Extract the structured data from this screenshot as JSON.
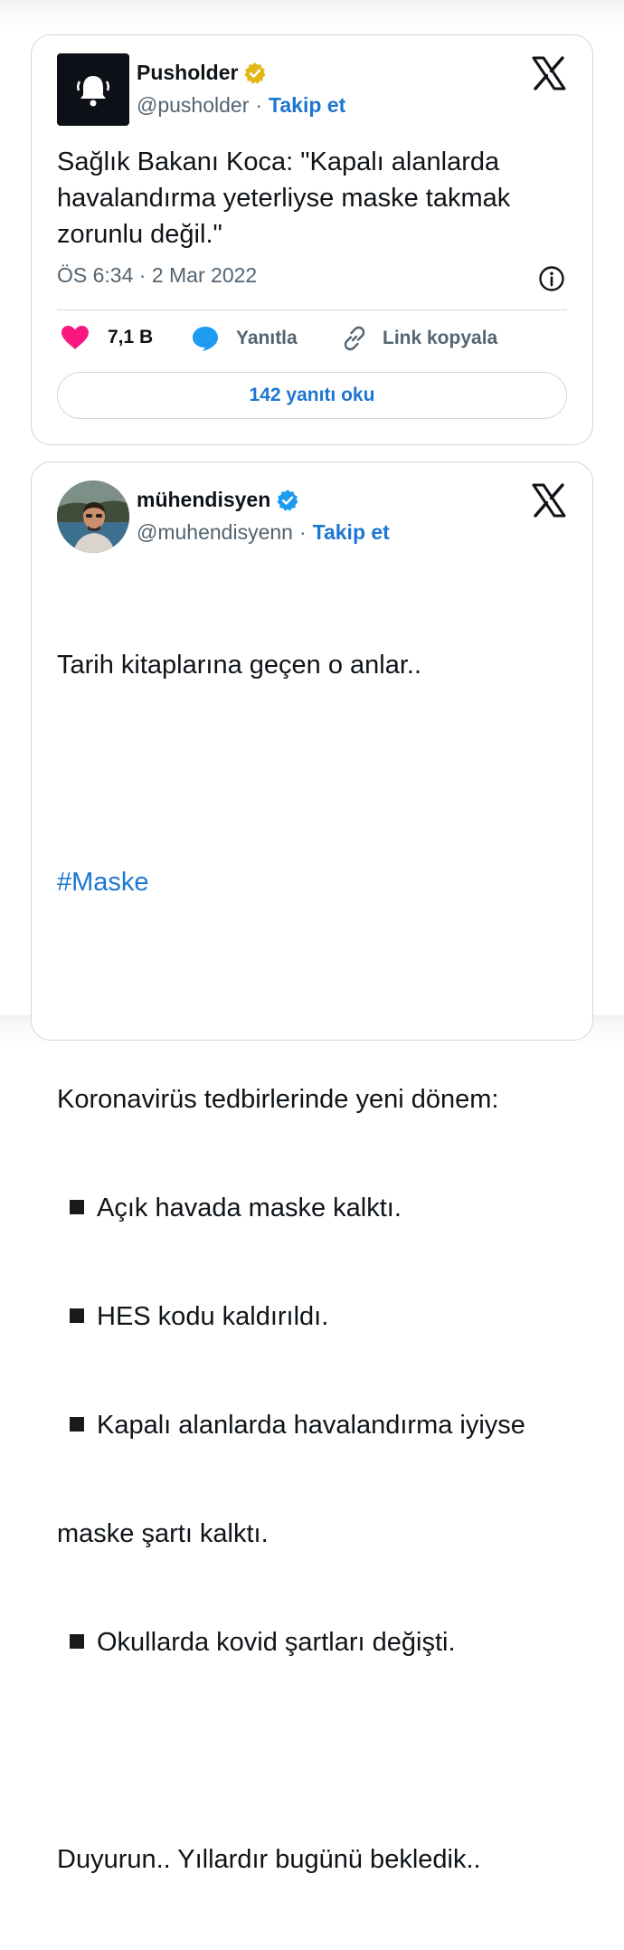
{
  "tweets": [
    {
      "name": "Pusholder",
      "handle": "@pusholder",
      "separator": "·",
      "follow": "Takip et",
      "verified": "gold",
      "text": "Sağlık Bakanı Koca: \"Kapalı alanlarda havalandırma yeterliyse maske takmak zorunlu değil.\"",
      "time": "ÖS 6:34",
      "date_sep": "·",
      "date": "2 Mar 2022",
      "likes": "7,1 B",
      "reply_label": "Yanıtla",
      "copy_link_label": "Link kopyala",
      "read_replies": "142 yanıtı oku"
    },
    {
      "name": "mühendisyen",
      "handle": "@muhendisyenn",
      "separator": "·",
      "follow": "Takip et",
      "verified": "blue",
      "lines": {
        "intro": "Tarih kitaplarına geçen o anlar..",
        "hashtag": "#Maske",
        "heading": "Koronavirüs tedbirlerinde yeni dönem:",
        "bullet1": "Açık havada maske kalktı.",
        "bullet2": "HES kodu kaldırıldı.",
        "bullet3a": "Kapalı alanlarda havalandırma iyiyse",
        "bullet3b": "maske şartı kalktı.",
        "bullet4": "Okullarda kovid şartları değişti.",
        "closing": "Duyurun.. Yıllardır bugünü bekledik.."
      }
    }
  ],
  "colors": {
    "accent": "#1d76d2",
    "like": "#f91880",
    "verified_gold": "#e2b719",
    "verified_blue": "#1d9bf0",
    "muted": "#536471",
    "border": "#cfd9de"
  },
  "icons": [
    "bell-icon",
    "x-logo-icon",
    "verified-badge-icon",
    "heart-icon",
    "reply-bubble-icon",
    "link-icon",
    "info-icon"
  ]
}
